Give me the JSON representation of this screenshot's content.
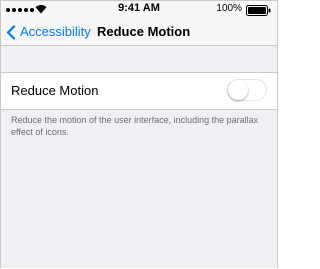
{
  "status_bar": {
    "time": "9:41 AM",
    "battery_percent": "100%",
    "signal_icon": "signal-dots-icon",
    "wifi_icon": "wifi-icon",
    "battery_icon": "battery-full-icon"
  },
  "nav": {
    "back_label": "Accessibility",
    "title": "Reduce Motion",
    "back_icon": "chevron-left-icon"
  },
  "settings": {
    "reduce_motion": {
      "label": "Reduce Motion",
      "enabled": false
    },
    "footer": "Reduce the motion of the user interface, including the parallax effect of icons."
  },
  "colors": {
    "accent": "#007aff",
    "background": "#efeff4",
    "bar": "#f7f7f7",
    "separator": "#c8c7cc",
    "footer_text": "#6d6d72"
  }
}
